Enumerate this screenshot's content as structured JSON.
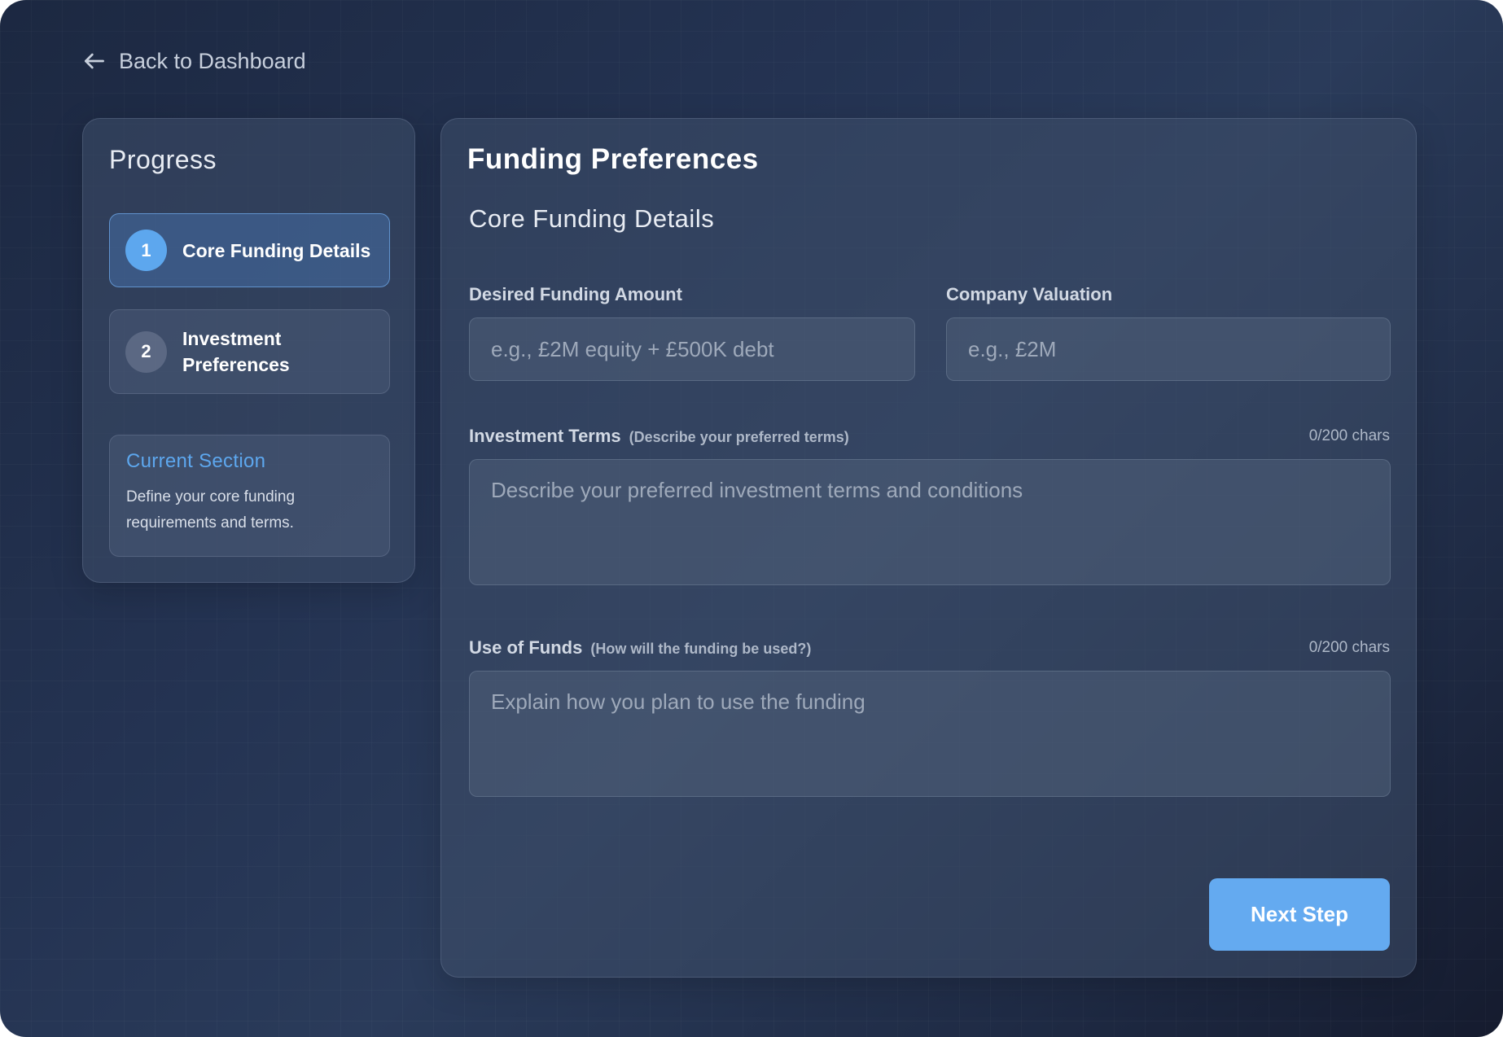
{
  "nav": {
    "back_label": "Back to Dashboard"
  },
  "sidebar": {
    "title": "Progress",
    "steps": [
      {
        "number": "1",
        "label": "Core Funding Details",
        "active": true
      },
      {
        "number": "2",
        "label": "Investment Preferences",
        "active": false
      }
    ],
    "current_section": {
      "title": "Current Section",
      "description": "Define your core funding requirements and terms."
    }
  },
  "main": {
    "title": "Funding Preferences",
    "section_title": "Core Funding Details",
    "fields": {
      "funding_amount": {
        "label": "Desired Funding Amount",
        "value": "",
        "placeholder": "e.g., £2M equity + £500K debt"
      },
      "valuation": {
        "label": "Company Valuation",
        "value": "",
        "placeholder": "e.g., £2M"
      },
      "investment_terms": {
        "label": "Investment Terms",
        "hint": "(Describe your preferred terms)",
        "counter": "0/200 chars",
        "value": "",
        "placeholder": "Describe your preferred investment terms and conditions"
      },
      "use_of_funds": {
        "label": "Use of Funds",
        "hint": "(How will the funding be used?)",
        "counter": "0/200 chars",
        "value": "",
        "placeholder": "Explain how you plan to use the funding"
      }
    },
    "next_label": "Next Step"
  },
  "theme": {
    "accent": "#5da7ee",
    "button": "#64aaf0",
    "background": "#243352"
  }
}
